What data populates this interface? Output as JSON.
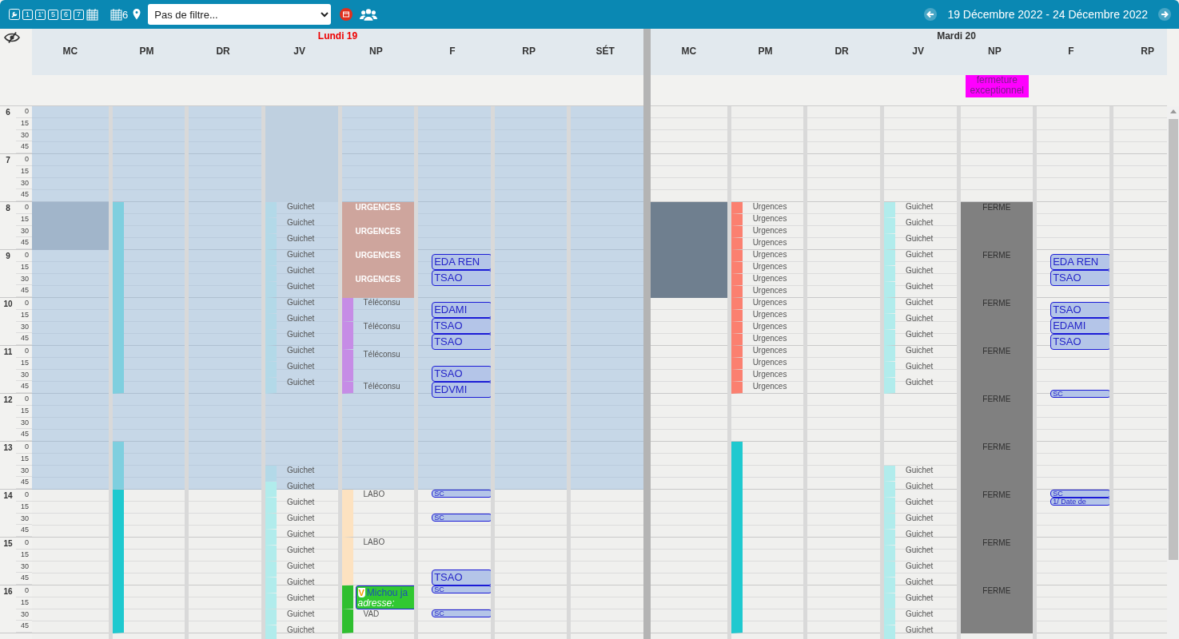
{
  "toolbar": {
    "view_buttons": [
      "1",
      "1'",
      "5",
      "6",
      "7"
    ],
    "calendar_count": "6",
    "filter": "Pas de filtre...",
    "date_range": "19 Décembre 2022 - 24 Décembre 2022"
  },
  "hours": [
    {
      "hour": "6",
      "minutes": [
        "0",
        "15",
        "30",
        "45"
      ]
    },
    {
      "hour": "7",
      "minutes": [
        "0",
        "15",
        "30",
        "45"
      ]
    },
    {
      "hour": "8",
      "minutes": [
        "0",
        "15",
        "30",
        "45"
      ]
    },
    {
      "hour": "9",
      "minutes": [
        "0",
        "15",
        "30",
        "45"
      ]
    },
    {
      "hour": "10",
      "minutes": [
        "0",
        "15",
        "30",
        "45"
      ]
    },
    {
      "hour": "11",
      "minutes": [
        "0",
        "15",
        "30",
        "45"
      ]
    },
    {
      "hour": "12",
      "minutes": [
        "0",
        "15",
        "30",
        "45"
      ]
    },
    {
      "hour": "13",
      "minutes": [
        "0",
        "15",
        "30",
        "45"
      ]
    },
    {
      "hour": "14",
      "minutes": [
        "0",
        "15",
        "30",
        "45"
      ]
    },
    {
      "hour": "15",
      "minutes": [
        "0",
        "15",
        "30",
        "45"
      ]
    },
    {
      "hour": "16",
      "minutes": [
        "0",
        "15",
        "30",
        "45"
      ]
    }
  ],
  "days": [
    {
      "title": "Lundi 19",
      "today": true,
      "shaded": true,
      "columns": [
        {
          "name": "MC",
          "events": [
            {
              "kind": "block",
              "color": "#a1b5ca"
            }
          ]
        },
        {
          "name": "PM",
          "events": [
            {
              "kind": "stripe",
              "color": "#7fcfdf"
            },
            {
              "kind": "stripe",
              "color": "#7fcfdf"
            },
            {
              "kind": "stripe",
              "color": "#1fc9cf"
            }
          ]
        },
        {
          "name": "DR"
        },
        {
          "name": "JV",
          "events": [
            {
              "kind": "block",
              "color": "#bfd0e0"
            },
            {
              "kind": "stripe",
              "label": "Guichet",
              "color": "#b3d9e8"
            },
            {
              "kind": "stripe",
              "label": "Guichet",
              "color": "#b3d9e8"
            },
            {
              "kind": "stripe",
              "label": "Guichet",
              "color": "#b3d9e8"
            },
            {
              "kind": "stripe",
              "label": "Guichet",
              "color": "#b3d9e8"
            },
            {
              "kind": "stripe",
              "label": "Guichet",
              "color": "#b3d9e8"
            },
            {
              "kind": "stripe",
              "label": "Guichet",
              "color": "#b3d9e8"
            },
            {
              "kind": "stripe",
              "label": "Guichet",
              "color": "#b3d9e8"
            },
            {
              "kind": "stripe",
              "label": "Guichet",
              "color": "#b3d9e8"
            },
            {
              "kind": "stripe",
              "label": "Guichet",
              "color": "#b3d9e8"
            },
            {
              "kind": "stripe",
              "label": "Guichet",
              "color": "#b3d9e8"
            },
            {
              "kind": "stripe",
              "label": "Guichet",
              "color": "#b3d9e8"
            },
            {
              "kind": "stripe",
              "label": "Guichet",
              "color": "#b3d9e8"
            },
            {
              "kind": "stripe",
              "label": "Guichet",
              "color": "#b3d9e8"
            },
            {
              "kind": "stripe",
              "label": "Guichet",
              "color": "#b1ecec"
            },
            {
              "kind": "stripe",
              "label": "Guichet",
              "color": "#b1ecec"
            },
            {
              "kind": "stripe",
              "label": "Guichet",
              "color": "#b1ecec"
            },
            {
              "kind": "stripe",
              "label": "Guichet",
              "color": "#b1ecec"
            },
            {
              "kind": "stripe",
              "label": "Guichet",
              "color": "#b1ecec"
            },
            {
              "kind": "stripe",
              "label": "Guichet",
              "color": "#b1ecec"
            },
            {
              "kind": "stripe",
              "label": "Guichet",
              "color": "#b1ecec"
            },
            {
              "kind": "stripe",
              "label": "Guichet",
              "color": "#b1ecec"
            },
            {
              "kind": "stripe",
              "label": "Guichet",
              "color": "#b1ecec"
            },
            {
              "kind": "stripe",
              "label": "Guichet",
              "color": "#b1ecec"
            }
          ]
        },
        {
          "name": "NP",
          "events": [
            {
              "kind": "block",
              "label": "URGENCES",
              "color": "#cea59d"
            },
            {
              "kind": "block",
              "label": "URGENCES",
              "color": "#cea59d"
            },
            {
              "kind": "block",
              "label": "URGENCES",
              "color": "#cea59d"
            },
            {
              "kind": "block",
              "label": "URGENCES",
              "color": "#cea59d"
            },
            {
              "kind": "stripe",
              "label": "Téléconsu",
              "color": "#c68ce6"
            },
            {
              "kind": "stripe",
              "label": "Téléconsu",
              "color": "#c68ce6"
            },
            {
              "kind": "stripe",
              "label": "Téléconsu",
              "color": "#c68ce6"
            },
            {
              "kind": "stripe",
              "label": "Téléconsu",
              "color": "#c68ce6"
            },
            {
              "kind": "stripe",
              "label": "LABO",
              "color": "#fde2c0"
            },
            {
              "kind": "stripe",
              "label": "LABO",
              "color": "#fde2c0"
            },
            {
              "kind": "stripe",
              "color": "#2fbf2f"
            },
            {
              "kind": "visit",
              "badge": "V",
              "label": "Michou ja",
              "detail": "adresse:",
              "color": "#31c831"
            },
            {
              "kind": "stripe",
              "label": "VAD",
              "color": "#2fbf2f"
            }
          ]
        },
        {
          "name": "F",
          "events": [
            {
              "kind": "booking",
              "label": "EDA REN",
              "color": "#b4c5e8"
            },
            {
              "kind": "booking",
              "label": "TSAO",
              "color": "#b4c5e8"
            },
            {
              "kind": "booking",
              "label": "EDAMI",
              "color": "#b4c5e8"
            },
            {
              "kind": "booking",
              "label": "TSAO",
              "color": "#b4c5e8"
            },
            {
              "kind": "booking",
              "label": "TSAO",
              "color": "#b4c5e8"
            },
            {
              "kind": "booking",
              "label": "TSAO",
              "color": "#b4c5e8"
            },
            {
              "kind": "booking",
              "label": "EDVMI",
              "color": "#b4c5e8"
            },
            {
              "kind": "booking",
              "label": "SC",
              "color": "#b4c5e8"
            },
            {
              "kind": "booking",
              "label": "SC",
              "color": "#b4c5e8"
            },
            {
              "kind": "booking",
              "label": "TSAO",
              "color": "#b4c5e8"
            },
            {
              "kind": "booking",
              "label": "SC",
              "color": "#b4c5e8"
            },
            {
              "kind": "booking",
              "label": "SC",
              "color": "#b4c5e8"
            }
          ]
        },
        {
          "name": "RP"
        },
        {
          "name": "SÉT"
        }
      ]
    },
    {
      "title": "Mardi 20",
      "today": false,
      "columns": [
        {
          "name": "MC",
          "events": [
            {
              "kind": "block",
              "color": "#6f7f8f"
            }
          ]
        },
        {
          "name": "PM",
          "events": [
            {
              "kind": "stripe",
              "label": "Urgences",
              "color": "#fb8070"
            },
            {
              "kind": "stripe",
              "label": "Urgences",
              "color": "#fb8070"
            },
            {
              "kind": "stripe",
              "label": "Urgences",
              "color": "#fb8070"
            },
            {
              "kind": "stripe",
              "label": "Urgences",
              "color": "#fb8070"
            },
            {
              "kind": "stripe",
              "label": "Urgences",
              "color": "#fb8070"
            },
            {
              "kind": "stripe",
              "label": "Urgences",
              "color": "#fb8070"
            },
            {
              "kind": "stripe",
              "label": "Urgences",
              "color": "#fb8070"
            },
            {
              "kind": "stripe",
              "label": "Urgences",
              "color": "#fb8070"
            },
            {
              "kind": "stripe",
              "label": "Urgences",
              "color": "#fb8070"
            },
            {
              "kind": "stripe",
              "label": "Urgences",
              "color": "#fb8070"
            },
            {
              "kind": "stripe",
              "label": "Urgences",
              "color": "#fb8070"
            },
            {
              "kind": "stripe",
              "label": "Urgences",
              "color": "#fb8070"
            },
            {
              "kind": "stripe",
              "label": "Urgences",
              "color": "#fb8070"
            },
            {
              "kind": "stripe",
              "label": "Urgences",
              "color": "#fb8070"
            },
            {
              "kind": "stripe",
              "label": "Urgences",
              "color": "#fb8070"
            },
            {
              "kind": "stripe",
              "label": "Urgences",
              "color": "#fb8070"
            },
            {
              "kind": "stripe",
              "color": "#1fc9cf"
            }
          ]
        },
        {
          "name": "DR"
        },
        {
          "name": "JV",
          "events": [
            {
              "kind": "stripe",
              "label": "Guichet",
              "color": "#b1ecec"
            },
            {
              "kind": "stripe",
              "label": "Guichet",
              "color": "#b1ecec"
            },
            {
              "kind": "stripe",
              "label": "Guichet",
              "color": "#b1ecec"
            },
            {
              "kind": "stripe",
              "label": "Guichet",
              "color": "#b1ecec"
            },
            {
              "kind": "stripe",
              "label": "Guichet",
              "color": "#b1ecec"
            },
            {
              "kind": "stripe",
              "label": "Guichet",
              "color": "#b1ecec"
            },
            {
              "kind": "stripe",
              "label": "Guichet",
              "color": "#b1ecec"
            },
            {
              "kind": "stripe",
              "label": "Guichet",
              "color": "#b1ecec"
            },
            {
              "kind": "stripe",
              "label": "Guichet",
              "color": "#b1ecec"
            },
            {
              "kind": "stripe",
              "label": "Guichet",
              "color": "#b1ecec"
            },
            {
              "kind": "stripe",
              "label": "Guichet",
              "color": "#b1ecec"
            },
            {
              "kind": "stripe",
              "label": "Guichet",
              "color": "#b1ecec"
            },
            {
              "kind": "stripe",
              "label": "Guichet",
              "color": "#b1ecec"
            },
            {
              "kind": "stripe",
              "label": "Guichet",
              "color": "#b1ecec"
            },
            {
              "kind": "stripe",
              "label": "Guichet",
              "color": "#b1ecec"
            },
            {
              "kind": "stripe",
              "label": "Guichet",
              "color": "#b1ecec"
            },
            {
              "kind": "stripe",
              "label": "Guichet",
              "color": "#b1ecec"
            },
            {
              "kind": "stripe",
              "label": "Guichet",
              "color": "#b1ecec"
            },
            {
              "kind": "stripe",
              "label": "Guichet",
              "color": "#b1ecec"
            },
            {
              "kind": "stripe",
              "label": "Guichet",
              "color": "#b1ecec"
            },
            {
              "kind": "stripe",
              "label": "Guichet",
              "color": "#b1ecec"
            },
            {
              "kind": "stripe",
              "label": "Guichet",
              "color": "#b1ecec"
            },
            {
              "kind": "stripe",
              "label": "Guichet",
              "color": "#b1ecec"
            }
          ]
        },
        {
          "name": "NP",
          "all_day": {
            "label": "fermeture exceptionnel",
            "color": "#ff00ff"
          },
          "events": [
            {
              "kind": "closed",
              "label": "FERME",
              "color": "#808080"
            },
            {
              "kind": "closed",
              "label": "FERME",
              "color": "#808080"
            },
            {
              "kind": "closed",
              "label": "FERME",
              "color": "#808080"
            },
            {
              "kind": "closed",
              "label": "FERME",
              "color": "#808080"
            },
            {
              "kind": "closed",
              "label": "FERME",
              "color": "#808080"
            },
            {
              "kind": "closed",
              "label": "FERME",
              "color": "#808080"
            },
            {
              "kind": "closed",
              "label": "FERME",
              "color": "#808080"
            },
            {
              "kind": "closed",
              "label": "FERME",
              "color": "#808080"
            },
            {
              "kind": "closed",
              "label": "FERME",
              "color": "#808080"
            }
          ]
        },
        {
          "name": "F",
          "events": [
            {
              "kind": "booking",
              "label": "EDA REN",
              "color": "#b4c5e8"
            },
            {
              "kind": "booking",
              "label": "TSAO",
              "color": "#b4c5e8"
            },
            {
              "kind": "booking",
              "label": "TSAO",
              "color": "#b4c5e8"
            },
            {
              "kind": "booking",
              "label": "EDAMI",
              "color": "#b4c5e8"
            },
            {
              "kind": "booking",
              "label": "TSAO",
              "color": "#b4c5e8"
            },
            {
              "kind": "booking",
              "label": "SC",
              "color": "#b4c5e8"
            },
            {
              "kind": "booking",
              "label": "SC",
              "color": "#b4c5e8"
            },
            {
              "kind": "booking",
              "label": "1/ Date de",
              "color": "#b4c5e8"
            }
          ]
        },
        {
          "name": "RP"
        }
      ]
    }
  ]
}
